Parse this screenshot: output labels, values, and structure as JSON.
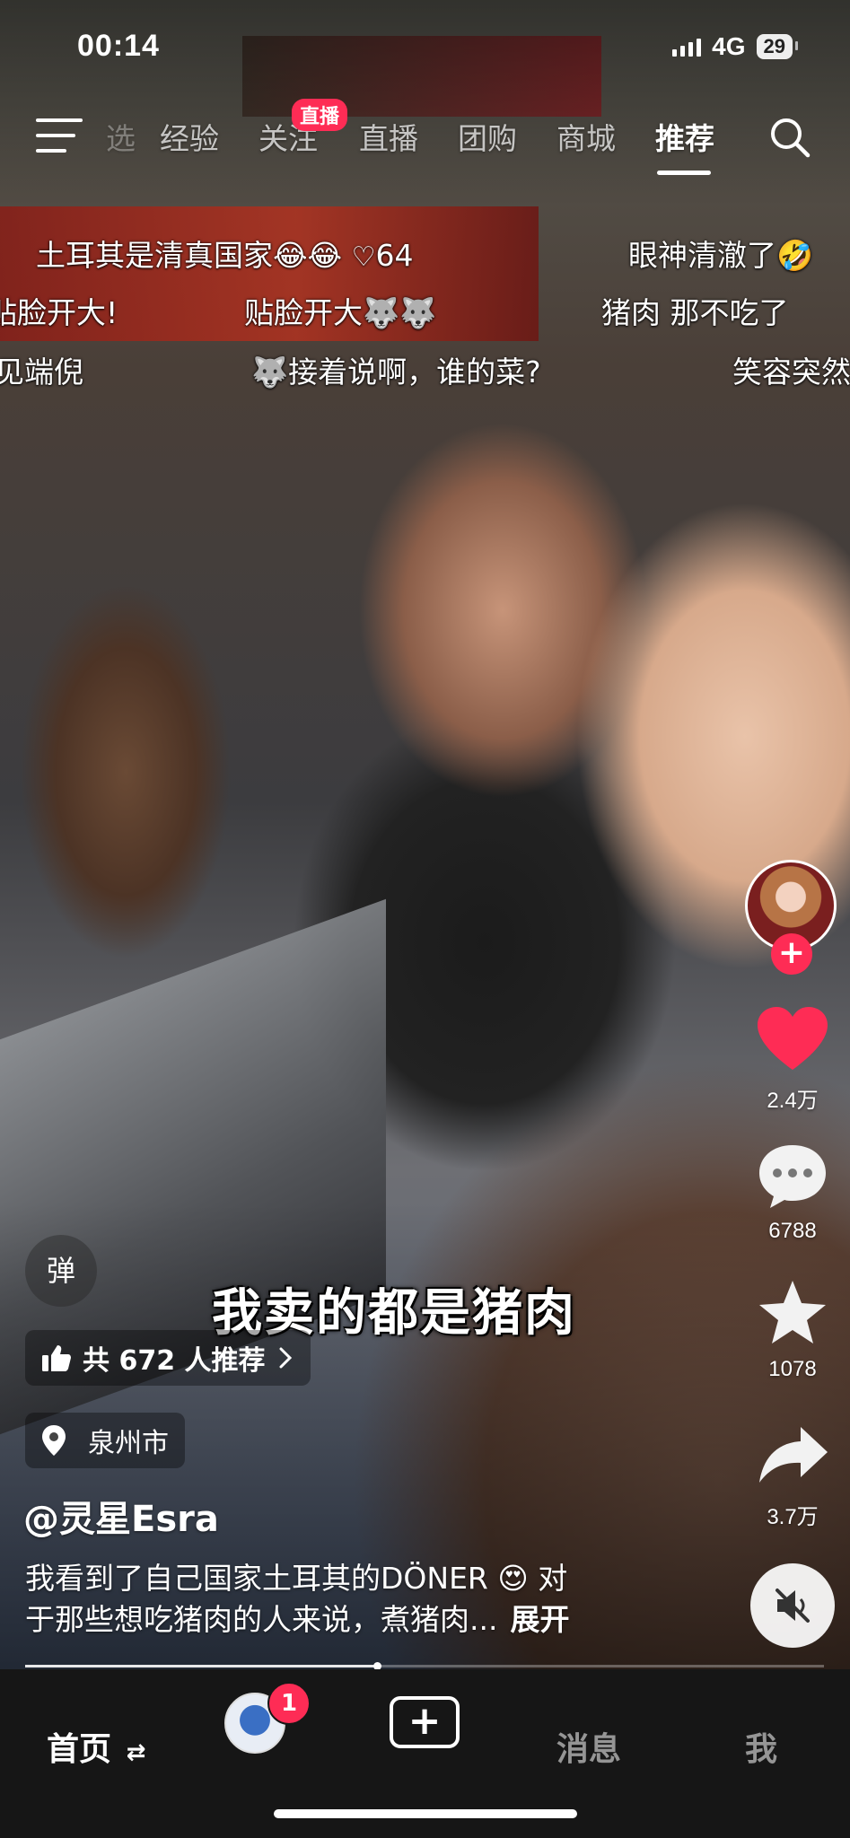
{
  "status_bar": {
    "time": "00:14",
    "network": "4G",
    "battery": "29"
  },
  "top_nav": {
    "tabs": [
      {
        "label": "经验",
        "active": false
      },
      {
        "label": "关注",
        "active": false
      },
      {
        "label": "直播",
        "active": false
      },
      {
        "label": "团购",
        "active": false
      },
      {
        "label": "商城",
        "active": false
      },
      {
        "label": "推荐",
        "active": true
      }
    ],
    "partial_tab": "选",
    "live_badge": "直播",
    "menu_icon": "menu-icon",
    "search_icon": "search-icon"
  },
  "danmaku": [
    {
      "text": "土耳其是清真国家😂😂",
      "likes": "64"
    },
    {
      "text": "眼神清澈了🤣"
    },
    {
      "text": "贴脸开大!"
    },
    {
      "text": "贴脸开大🐺🐺"
    },
    {
      "text": "猪肉 那不吃了"
    },
    {
      "text": "见端倪"
    },
    {
      "text": "🐺接着说啊，谁的菜?"
    },
    {
      "text": "笑容突然"
    }
  ],
  "video": {
    "subtitle": "我卖的都是猪肉"
  },
  "right_rail": {
    "like_count": "2.4万",
    "comment_count": "6788",
    "favorite_count": "1078",
    "share_count": "3.7万",
    "follow_icon": "plus-icon",
    "mute_icon": "muted-speaker-icon"
  },
  "info": {
    "danmaku_toggle": "弹",
    "recommend": "共 672 人推荐",
    "location": "泉州市",
    "username": "@灵星Esra",
    "caption_line1": "我看到了自己国家土耳其的DÖNER 😍 对",
    "caption_line2": "于那些想吃猪肉的人来说，煮猪肉...",
    "expand": "展开"
  },
  "progress": {
    "fraction": 0.44
  },
  "bottom_nav": {
    "home": "首页",
    "home_swap_icon": "⇄",
    "friends_badge": "1",
    "create_label": "+",
    "messages": "消息",
    "me": "我"
  },
  "colors": {
    "accent": "#fe2c55",
    "nav_bg": "#161616"
  }
}
